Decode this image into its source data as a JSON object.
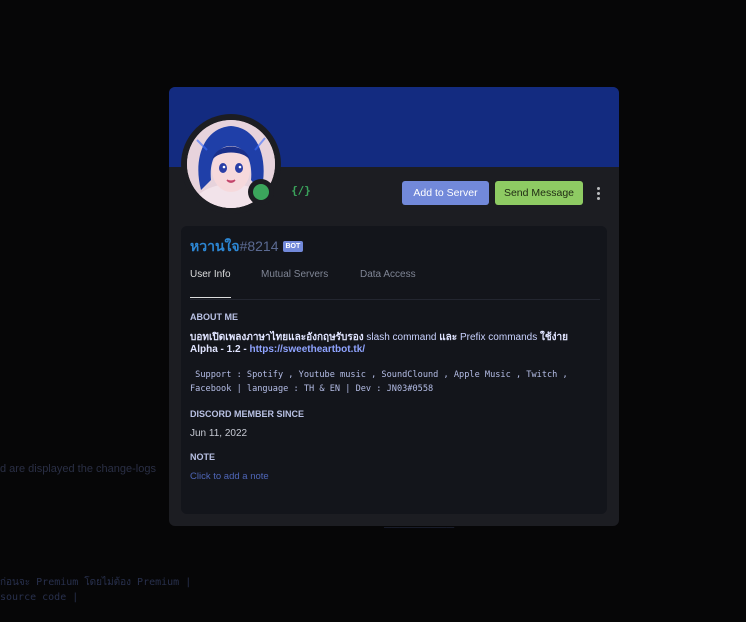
{
  "background": {
    "line1": "d are displayed the change-logs",
    "line2": "ก่อนจะ Premium โดยไม่ต้อง Premium |",
    "line3": "  source code |",
    "line4": "─────────"
  },
  "profile": {
    "banner_color": "#132b80",
    "status": "online",
    "slash_icon": "{/}",
    "buttons": {
      "add_to_server": "Add to Server",
      "send_message": "Send Message"
    },
    "username": "หวานใจ",
    "discriminator": "#8214",
    "bot_tag": "BOT",
    "tabs": [
      "User Info",
      "Mutual Servers",
      "Data Access"
    ],
    "active_tab": "User Info",
    "about_title": "ABOUT ME",
    "about": {
      "line1_a": "บอทเปิดเพลงภาษาไทยและอังกฤษรับรอง ",
      "line1_b": "slash command",
      "line1_c": " และ ",
      "line1_d": "Prefix commands",
      "line1_e": " ใช้ง่าย",
      "line2_a": "Alpha - ",
      "line2_b": "1.2 - ",
      "line2_link": "https://sweetheartbot.tk/",
      "code1": " Support : Spotify , Youtube music , SoundClound , Apple Music , Twitch ,",
      "code2": "Facebook | language : TH & EN | Dev : JN03#0558"
    },
    "member_since_title": "DISCORD MEMBER SINCE",
    "member_since": "Jun 11, 2022",
    "note_title": "NOTE",
    "note_placeholder": "Click to add a note"
  }
}
